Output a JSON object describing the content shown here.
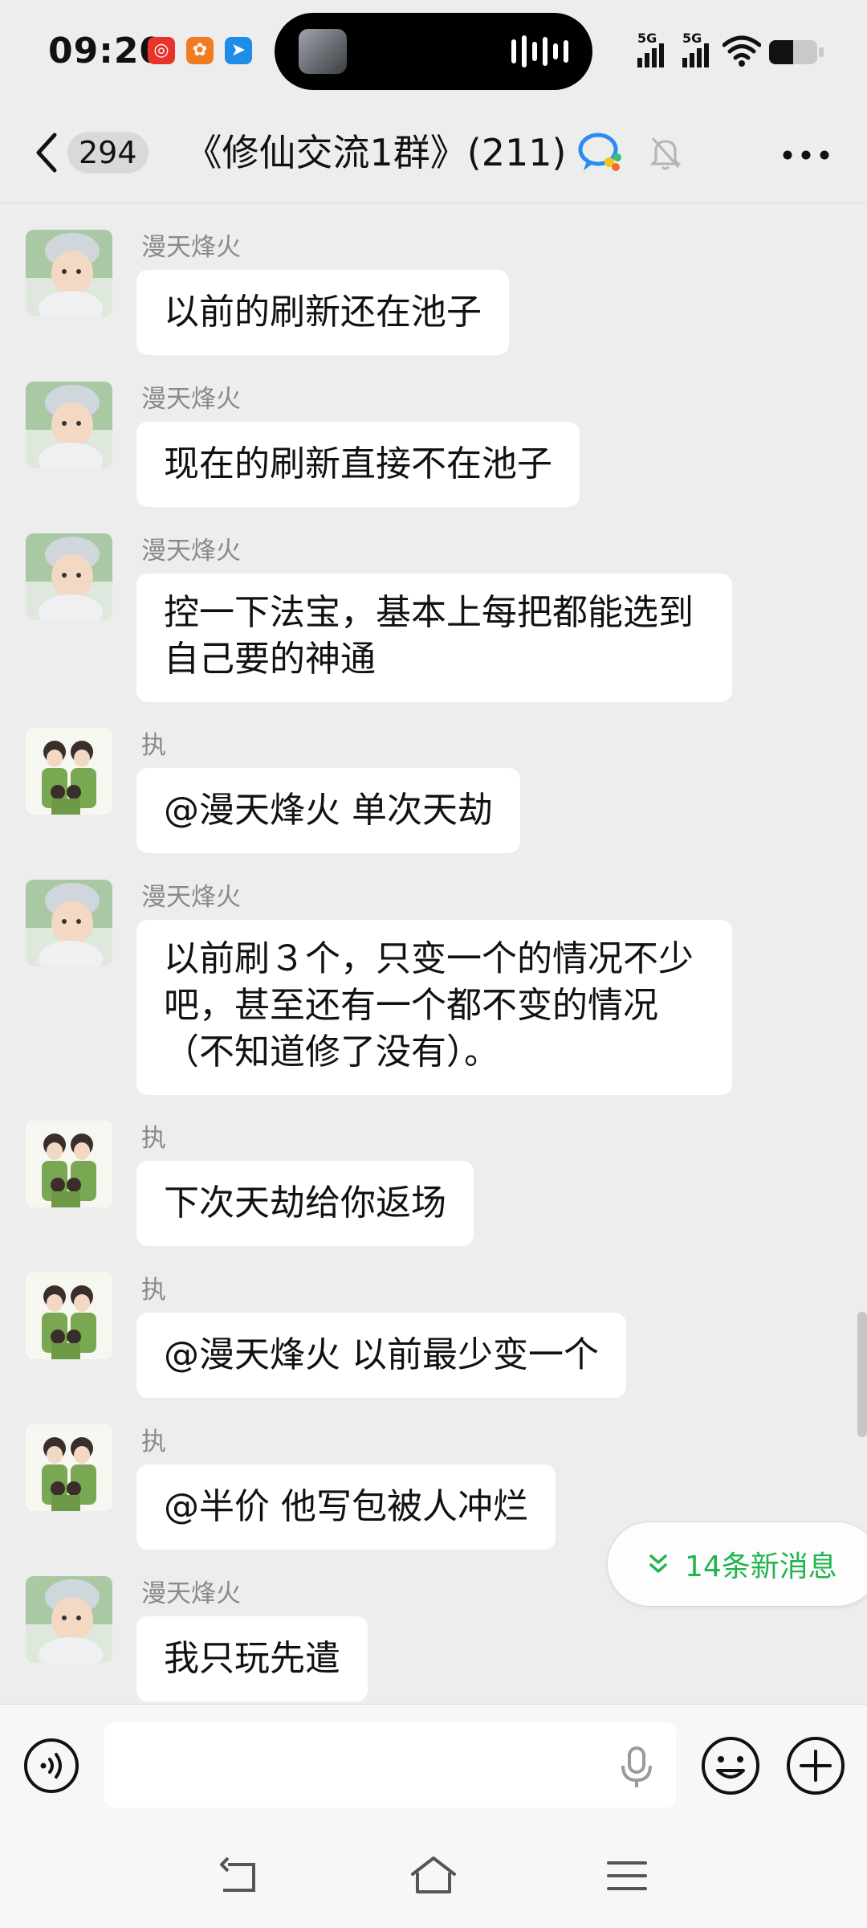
{
  "status_bar": {
    "time": "09:20",
    "network_1": "5G",
    "network_2": "5G",
    "battery_percent": 50
  },
  "header": {
    "unread_count": "294",
    "title": "《修仙交流1群》(211)",
    "icons": [
      "back-arrow-icon",
      "group-bubble-icon",
      "mute-bell-icon",
      "more-dots-icon"
    ]
  },
  "messages": [
    {
      "sender": "漫天烽火",
      "avatar": "baby-avatar",
      "text": "以前的刷新还在池子"
    },
    {
      "sender": "漫天烽火",
      "avatar": "baby-avatar",
      "text": "现在的刷新直接不在池子"
    },
    {
      "sender": "漫天烽火",
      "avatar": "baby-avatar",
      "text": "控一下法宝，基本上每把都能选到\n自己要的神通"
    },
    {
      "sender": "执",
      "avatar": "couple-avatar",
      "text": "@漫天烽火  单次天劫"
    },
    {
      "sender": "漫天烽火",
      "avatar": "baby-avatar",
      "text": "以前刷３个，只变一个的情况不少\n吧，甚至还有一个都不变的情况\n（不知道修了没有）。"
    },
    {
      "sender": "执",
      "avatar": "couple-avatar",
      "text": "下次天劫给你返场"
    },
    {
      "sender": "执",
      "avatar": "couple-avatar",
      "text": "@漫天烽火  以前最少变一个"
    },
    {
      "sender": "执",
      "avatar": "couple-avatar",
      "text": "@半价  他写包被人冲烂"
    },
    {
      "sender": "漫天烽火",
      "avatar": "baby-avatar",
      "text": "我只玩先遣"
    }
  ],
  "new_messages_pill": {
    "label": "14条新消息"
  },
  "input_bar": {
    "value": "",
    "placeholder": ""
  },
  "colors": {
    "background": "#ededed",
    "bubble": "#ffffff",
    "accent_green": "#21b44d"
  }
}
